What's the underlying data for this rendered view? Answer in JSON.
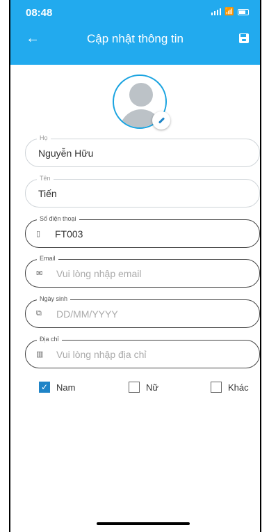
{
  "status": {
    "time": "08:48"
  },
  "header": {
    "title": "Cập nhật thông tin"
  },
  "fields": [
    {
      "label": "Họ",
      "value": "Nguyễn Hữu"
    },
    {
      "label": "Tên",
      "value": "Tiến"
    },
    {
      "label": "Số điện thoại",
      "value": "FT003",
      "icon": "phone-icon"
    },
    {
      "label": "Email",
      "placeholder": "Vui lòng nhập email",
      "icon": "mail-icon"
    },
    {
      "label": "Ngày sinh",
      "placeholder": "DD/MM/YYYY",
      "icon": "cake-icon"
    },
    {
      "label": "Địa chỉ",
      "placeholder": "Vui lòng nhập địa chỉ",
      "icon": "building-icon"
    }
  ],
  "gender": {
    "options": [
      {
        "label": "Nam",
        "checked": true
      },
      {
        "label": "Nữ",
        "checked": false
      },
      {
        "label": "Khác",
        "checked": false
      }
    ]
  },
  "colors": {
    "accent": "#22aaee"
  }
}
